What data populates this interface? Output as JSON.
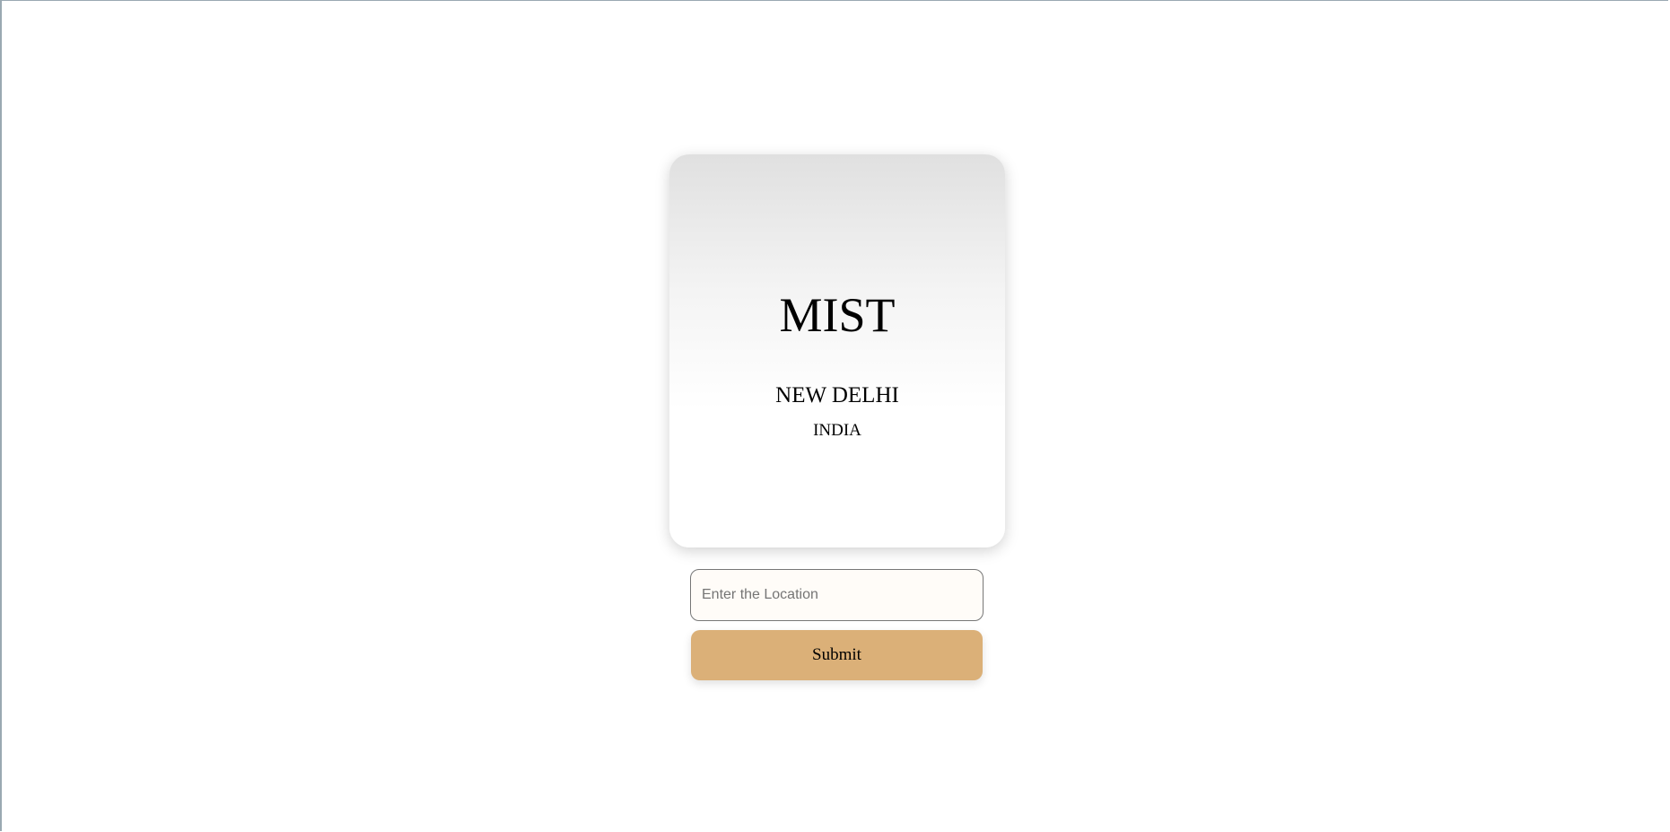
{
  "weather": {
    "condition": "MIST",
    "city": "NEW DELHI",
    "country": "INDIA"
  },
  "search": {
    "placeholder": "Enter the Location",
    "value": ""
  },
  "actions": {
    "submit_label": "Submit"
  },
  "colors": {
    "button": "#dbb078",
    "input_background": "#fffcf8",
    "card_gradient_top": "#e0e0e0",
    "card_gradient_bottom": "#ffffff"
  }
}
